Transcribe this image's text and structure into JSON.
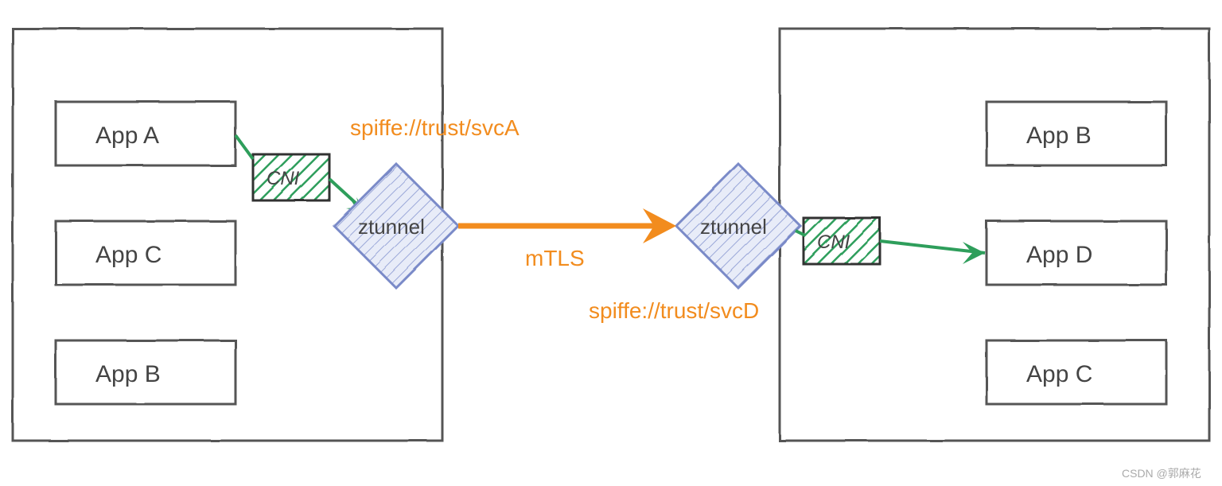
{
  "left_node": {
    "apps": [
      "App A",
      "App C",
      "App B"
    ],
    "cni": "CNI",
    "ztunnel": "ztunnel"
  },
  "right_node": {
    "apps": [
      "App B",
      "App D",
      "App C"
    ],
    "cni": "CNI",
    "ztunnel": "ztunnel"
  },
  "labels": {
    "spiffe_a": "spiffe://trust/svcA",
    "spiffe_d": "spiffe://trust/svcD",
    "mtls": "mTLS"
  },
  "attribution": "CSDN @郭麻花",
  "colors": {
    "orange": "#f28c1e",
    "green": "#2e9e5b",
    "blue_fill": "#e8ecf8",
    "blue_stroke": "#7a8ac8",
    "box_stroke": "#555555"
  }
}
